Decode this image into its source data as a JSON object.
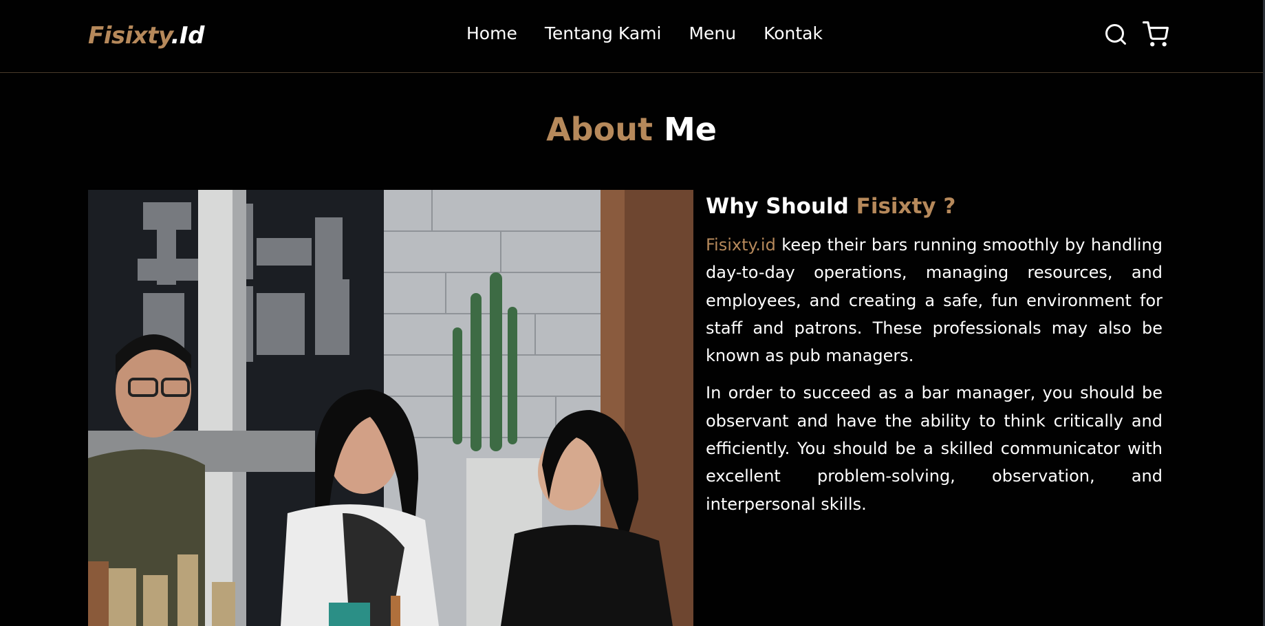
{
  "logo": {
    "brand": "Fisixty",
    "suffix": ".Id"
  },
  "nav": {
    "links": [
      {
        "label": "Home"
      },
      {
        "label": "Tentang Kami"
      },
      {
        "label": "Menu"
      },
      {
        "label": "Kontak"
      }
    ],
    "icons": [
      "search-icon",
      "cart-icon"
    ]
  },
  "about": {
    "title_accent": "About",
    "title_rest": "Me",
    "heading_prefix": "Why Should",
    "heading_accent": "Fisixty ?",
    "para1_accent": "Fisixty.id",
    "para1_text": " keep their bars running smoothly by handling day-to-day operations, managing resources, and employees, and creating a safe, fun environment for staff and patrons. These professionals may also be known as pub managers.",
    "para2_text": "In order to succeed as a bar manager, you should be observant and have the ability to think critically and efficiently. You should be a skilled communicator with excellent problem-solving, observation, and interpersonal skills."
  },
  "colors": {
    "accent": "#b6895b",
    "background": "#010101",
    "text": "#ffffff"
  }
}
